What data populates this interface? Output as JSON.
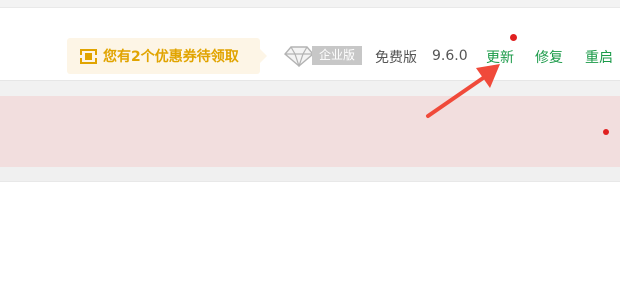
{
  "header": {
    "coupon_text": "您有2个优惠券待领取",
    "edition_badge": "企业版",
    "free_label": "免费版",
    "version": "9.6.0",
    "actions": {
      "update": "更新",
      "repair": "修复",
      "restart": "重启"
    }
  },
  "icons": {
    "coupon": "coupon-icon",
    "edition": "diamond-icon"
  },
  "colors": {
    "coupon_text": "#e1a400",
    "coupon_bg": "#fdf5e6",
    "action_green": "#1c9b4a",
    "alert_bg": "#f2dede",
    "notification_dot": "#e02020",
    "annotation_arrow": "#f04a3a"
  }
}
